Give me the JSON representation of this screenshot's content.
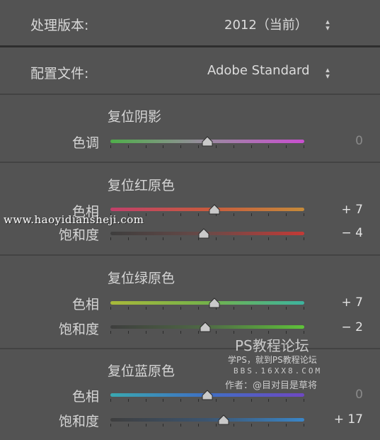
{
  "header": {
    "process_label": "处理版本:",
    "process_value": "2012（当前）",
    "profile_label": "配置文件:",
    "profile_value": "Adobe Standard"
  },
  "sections": [
    {
      "title": "复位阴影",
      "rows": [
        {
          "label": "色调",
          "value": "0",
          "level": 0,
          "gradient": "linear-gradient(to right,#4fae4a,#9a8aa0,#c94fd0)"
        }
      ]
    },
    {
      "title": "复位红原色",
      "rows": [
        {
          "label": "色相",
          "value": "+ 7",
          "level": 7,
          "gradient": "linear-gradient(to right,#c0406a,#c85a3e,#c58a3a)"
        },
        {
          "label": "饱和度",
          "value": "− 4",
          "level": -4,
          "gradient": "linear-gradient(to right,#3e3e3e,#6a4a48,#c43a36)"
        }
      ]
    },
    {
      "title": "复位绿原色",
      "rows": [
        {
          "label": "色相",
          "value": "+ 7",
          "level": 7,
          "gradient": "linear-gradient(to right,#a8b83a,#74b24a,#3db39e)"
        },
        {
          "label": "饱和度",
          "value": "− 2",
          "level": -2,
          "gradient": "linear-gradient(to right,#3e3e3e,#4f6a45,#5fc23a)"
        }
      ]
    },
    {
      "title": "复位蓝原色",
      "rows": [
        {
          "label": "色相",
          "value": "0",
          "level": 0,
          "gradient": "linear-gradient(to right,#3aa8b0,#3f6fc4,#6e48c2)"
        },
        {
          "label": "饱和度",
          "value": "+ 17",
          "level": 17,
          "gradient": "linear-gradient(to right,#3e3e3e,#3c5570,#3a86c8)"
        }
      ]
    }
  ],
  "watermark": {
    "url": "www.haoyidiansheji.com",
    "forum_title": "PS教程论坛",
    "forum_sub": "学PS，就到PS教程论坛",
    "forum_site": "BBS.16XX8.COM",
    "author": "作者：@目对目是草将"
  },
  "colors": {
    "background": "#535353",
    "separator": "#434343"
  }
}
